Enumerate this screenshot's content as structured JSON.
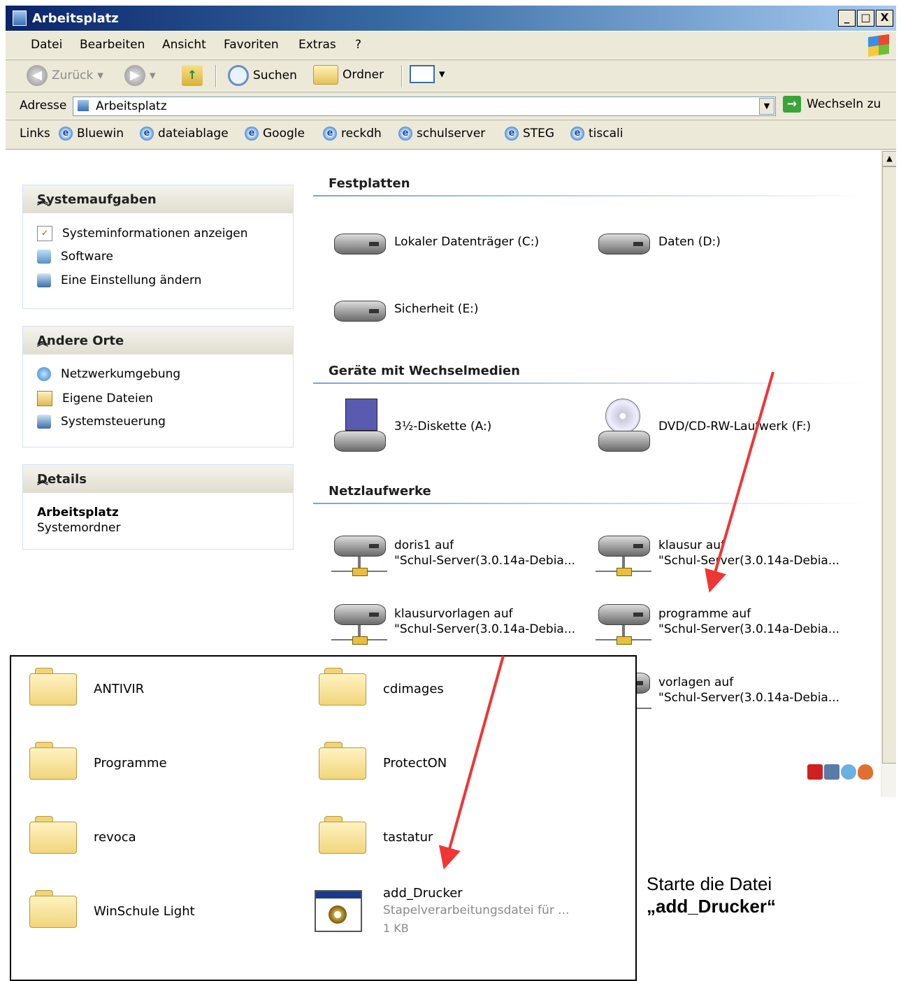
{
  "window": {
    "title": "Arbeitsplatz",
    "controls": [
      "_",
      "□",
      "X"
    ]
  },
  "menu": {
    "items": [
      {
        "label": "Datei"
      },
      {
        "label": "Bearbeiten"
      },
      {
        "label": "Ansicht"
      },
      {
        "label": "Favoriten"
      },
      {
        "label": "Extras"
      },
      {
        "label": "?"
      }
    ]
  },
  "toolbar": {
    "back_label": "Zurück",
    "search_label": "Suchen",
    "folders_label": "Ordner"
  },
  "address": {
    "label": "Adresse",
    "value": "Arbeitsplatz",
    "go_label": "Wechseln zu"
  },
  "links": {
    "label": "Links",
    "items": [
      {
        "label": "Bluewin"
      },
      {
        "label": "dateiablage"
      },
      {
        "label": "Google"
      },
      {
        "label": "reckdh"
      },
      {
        "label": "schulserver"
      },
      {
        "label": "STEG"
      },
      {
        "label": "tiscali"
      }
    ]
  },
  "sidebar": {
    "system_tasks": {
      "title": "Systemaufgaben",
      "items": [
        {
          "label": "Systeminformationen anzeigen",
          "icon": "info-icon"
        },
        {
          "label": "Software",
          "icon": "software-icon"
        },
        {
          "label": "Eine Einstellung ändern",
          "icon": "settings-icon"
        }
      ]
    },
    "other_places": {
      "title": "Andere Orte",
      "items": [
        {
          "label": "Netzwerkumgebung",
          "icon": "network-icon"
        },
        {
          "label": "Eigene Dateien",
          "icon": "documents-icon"
        },
        {
          "label": "Systemsteuerung",
          "icon": "control-panel-icon"
        }
      ]
    },
    "details": {
      "title": "Details",
      "name": "Arbeitsplatz",
      "type": "Systemordner"
    }
  },
  "groups": {
    "hard_disks": {
      "title": "Festplatten",
      "items": [
        {
          "label": "Lokaler Datenträger (C:)"
        },
        {
          "label": "Daten (D:)"
        },
        {
          "label": "Sicherheit (E:)"
        }
      ]
    },
    "removable": {
      "title": "Geräte mit Wechselmedien",
      "items": [
        {
          "label": "3½-Diskette (A:)"
        },
        {
          "label": "DVD/CD-RW-Laufwerk (F:)"
        }
      ]
    },
    "network": {
      "title": "Netzlaufwerke",
      "items": [
        {
          "line1": "doris1 auf",
          "line2": "\"Schul-Server(3.0.14a-Debia..."
        },
        {
          "line1": "klausur auf",
          "line2": "\"Schul-Server(3.0.14a-Debia..."
        },
        {
          "line1": "klausurvorlagen auf",
          "line2": "\"Schul-Server(3.0.14a-Debia..."
        },
        {
          "line1": "programme auf",
          "line2": "\"Schul-Server(3.0.14a-Debia..."
        },
        {
          "line1": "vorlagen auf",
          "line2": "\"Schul-Server(3.0.14a-Debia..."
        }
      ]
    }
  },
  "folder_view": {
    "items": [
      {
        "label": "ANTIVIR"
      },
      {
        "label": "cdimages"
      },
      {
        "label": "Programme"
      },
      {
        "label": "ProtectON"
      },
      {
        "label": "revoca"
      },
      {
        "label": "tastatur"
      },
      {
        "label": "WinSchule Light"
      }
    ],
    "batch_file": {
      "name": "add_Drucker",
      "type": "Stapelverarbeitungsdatei für ...",
      "size": "1 KB"
    }
  },
  "instruction": {
    "line1": "Starte die Datei",
    "line2": "„add_Drucker“"
  },
  "colors": {
    "arrow": "#f03535",
    "titlebar": "#0a246a"
  }
}
